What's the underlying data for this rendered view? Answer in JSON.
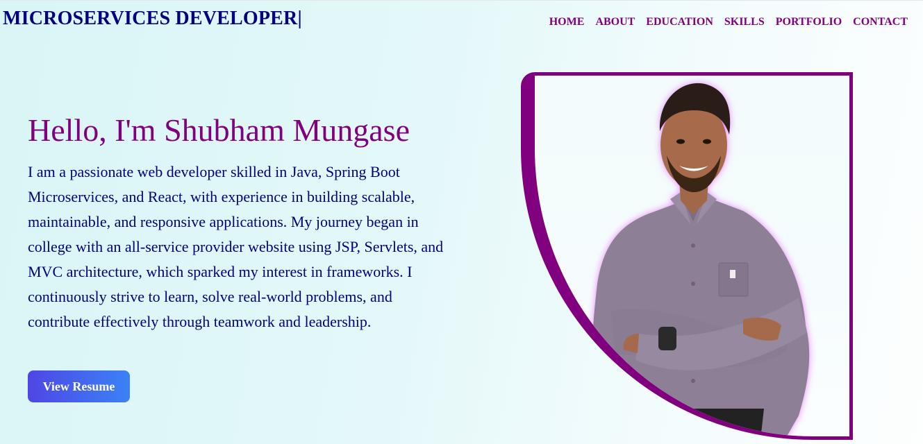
{
  "header": {
    "brand": "MICROSERVICES DEVELOPER",
    "cursor": "|",
    "nav": [
      "HOME",
      "ABOUT",
      "EDUCATION",
      "SKILLS",
      "PORTFOLIO",
      "CONTACT"
    ]
  },
  "hero": {
    "title": "Hello, I'm Shubham Mungase",
    "description": "I am a passionate web developer skilled in Java, Spring Boot Microservices, and React, with experience in building scalable, maintainable, and responsive applications. My journey began in college with an all-service provider website using JSP, Servlets, and MVC architecture, which sparked my interest in frameworks. I continuously strive to learn, solve real-world problems, and contribute effectively through teamwork and leadership.",
    "button": "View Resume"
  },
  "colors": {
    "brand": "#000080",
    "accent": "#800080",
    "button_start": "#4f46e5",
    "button_end": "#3b82f6"
  }
}
